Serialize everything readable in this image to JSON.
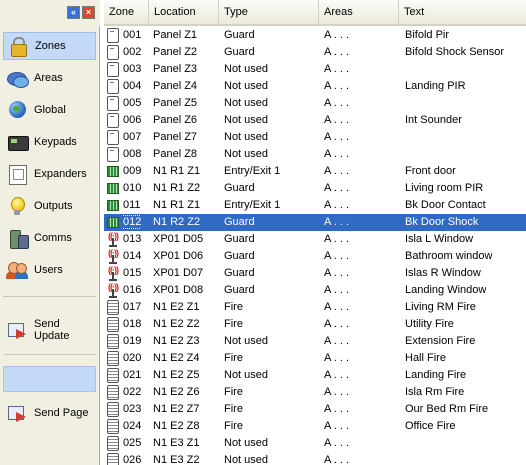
{
  "sidebar": {
    "items": [
      {
        "label": "Zones",
        "icon": "lock-icon",
        "selected": true
      },
      {
        "label": "Areas",
        "icon": "areas-icon"
      },
      {
        "label": "Global",
        "icon": "globe-icon"
      },
      {
        "label": "Keypads",
        "icon": "keypad-icon"
      },
      {
        "label": "Expanders",
        "icon": "expander-icon"
      },
      {
        "label": "Outputs",
        "icon": "bulb-icon"
      },
      {
        "label": "Comms",
        "icon": "phone-icon"
      },
      {
        "label": "Users",
        "icon": "users-icon"
      }
    ],
    "send_update_label": "Send Update",
    "send_page_label": "Send Page"
  },
  "grid": {
    "columns": [
      "Zone",
      "Location",
      "Type",
      "Areas",
      "Text"
    ],
    "selected_row": 11,
    "rows": [
      {
        "icon": "panel",
        "zone": "001",
        "location": "Panel Z1",
        "type": "Guard",
        "areas": "A . . .",
        "text": "Bifold Pir"
      },
      {
        "icon": "panel",
        "zone": "002",
        "location": "Panel Z2",
        "type": "Guard",
        "areas": "A . . .",
        "text": "Bifold Shock Sensor"
      },
      {
        "icon": "panel",
        "zone": "003",
        "location": "Panel Z3",
        "type": "Not used",
        "areas": "A . . .",
        "text": ""
      },
      {
        "icon": "panel",
        "zone": "004",
        "location": "Panel Z4",
        "type": "Not used",
        "areas": "A . . .",
        "text": "Landing PIR"
      },
      {
        "icon": "panel",
        "zone": "005",
        "location": "Panel Z5",
        "type": "Not used",
        "areas": "A . . .",
        "text": ""
      },
      {
        "icon": "panel",
        "zone": "006",
        "location": "Panel Z6",
        "type": "Not used",
        "areas": "A . . .",
        "text": "Int Sounder"
      },
      {
        "icon": "panel",
        "zone": "007",
        "location": "Panel Z7",
        "type": "Not used",
        "areas": "A . . .",
        "text": ""
      },
      {
        "icon": "panel",
        "zone": "008",
        "location": "Panel Z8",
        "type": "Not used",
        "areas": "A . . .",
        "text": ""
      },
      {
        "icon": "keypad",
        "zone": "009",
        "location": "N1 R1 Z1",
        "type": "Entry/Exit 1",
        "areas": "A . . .",
        "text": "Front door"
      },
      {
        "icon": "keypad",
        "zone": "010",
        "location": "N1 R1 Z2",
        "type": "Guard",
        "areas": "A . . .",
        "text": "Living room PIR"
      },
      {
        "icon": "keypad",
        "zone": "011",
        "location": "N1 R1 Z1",
        "type": "Entry/Exit 1",
        "areas": "A . . .",
        "text": "Bk Door Contact"
      },
      {
        "icon": "keypad",
        "zone": "012",
        "location": "N1 R2 Z2",
        "type": "Guard",
        "areas": "A . . .",
        "text": "Bk Door Shock"
      },
      {
        "icon": "radio",
        "zone": "013",
        "location": "XP01 D05",
        "type": "Guard",
        "areas": "A . . .",
        "text": "Isla L Window"
      },
      {
        "icon": "radio",
        "zone": "014",
        "location": "XP01 D06",
        "type": "Guard",
        "areas": "A . . .",
        "text": "Bathroom window"
      },
      {
        "icon": "radio",
        "zone": "015",
        "location": "XP01 D07",
        "type": "Guard",
        "areas": "A . . .",
        "text": "Islas R Window"
      },
      {
        "icon": "radio",
        "zone": "016",
        "location": "XP01 D08",
        "type": "Guard",
        "areas": "A . . .",
        "text": "Landing Window"
      },
      {
        "icon": "detector",
        "zone": "017",
        "location": "N1 E2 Z1",
        "type": "Fire",
        "areas": "A . . .",
        "text": "Living RM Fire"
      },
      {
        "icon": "detector",
        "zone": "018",
        "location": "N1 E2 Z2",
        "type": "Fire",
        "areas": "A . . .",
        "text": "Utility Fire"
      },
      {
        "icon": "detector",
        "zone": "019",
        "location": "N1 E2 Z3",
        "type": "Not used",
        "areas": "A . . .",
        "text": "Extension Fire"
      },
      {
        "icon": "detector",
        "zone": "020",
        "location": "N1 E2 Z4",
        "type": "Fire",
        "areas": "A . . .",
        "text": "Hall Fire"
      },
      {
        "icon": "detector",
        "zone": "021",
        "location": "N1 E2 Z5",
        "type": "Not used",
        "areas": "A . . .",
        "text": "Landing Fire"
      },
      {
        "icon": "detector",
        "zone": "022",
        "location": "N1 E2 Z6",
        "type": "Fire",
        "areas": "A . . .",
        "text": "Isla Rm Fire"
      },
      {
        "icon": "detector",
        "zone": "023",
        "location": "N1 E2 Z7",
        "type": "Fire",
        "areas": "A . . .",
        "text": "Our Bed Rm Fire"
      },
      {
        "icon": "detector",
        "zone": "024",
        "location": "N1 E2 Z8",
        "type": "Fire",
        "areas": "A . . .",
        "text": "Office Fire"
      },
      {
        "icon": "detector",
        "zone": "025",
        "location": "N1 E3 Z1",
        "type": "Not used",
        "areas": "A . . .",
        "text": ""
      },
      {
        "icon": "detector",
        "zone": "026",
        "location": "N1 E3 Z2",
        "type": "Not used",
        "areas": "A . . .",
        "text": ""
      }
    ]
  }
}
